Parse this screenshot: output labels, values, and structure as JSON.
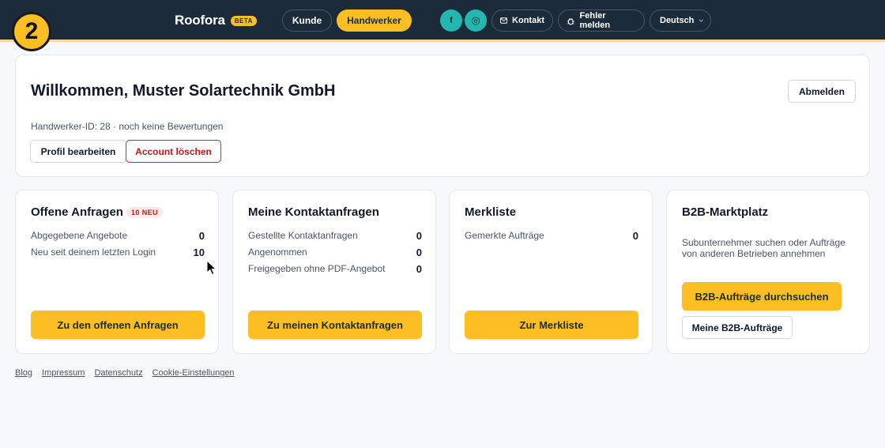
{
  "step_badge": "2",
  "header": {
    "brand": "Roofora",
    "beta": "BETA",
    "nav": {
      "kunde": "Kunde",
      "handwerker": "Handwerker"
    },
    "social": {
      "facebook": "f",
      "instagram": "◎"
    },
    "kontakt": "Kontakt",
    "fehler_melden": "Fehler melden",
    "language": "Deutsch"
  },
  "welcome": {
    "title": "Willkommen, Muster Solartechnik GmbH",
    "logout": "Abmelden",
    "meta": "Handwerker-ID: 28 · noch keine Bewertungen",
    "edit_profile": "Profil bearbeiten",
    "delete_account": "Account löschen"
  },
  "cards": {
    "offene": {
      "title": "Offene Anfragen",
      "badge": "10 NEU",
      "rows": [
        {
          "label": "Abgegebene Angebote",
          "value": "0"
        },
        {
          "label": "Neu seit deinem letzten Login",
          "value": "10"
        }
      ],
      "button": "Zu den offenen Anfragen"
    },
    "kontakt": {
      "title": "Meine Kontaktanfragen",
      "rows": [
        {
          "label": "Gestellte Kontaktanfragen",
          "value": "0"
        },
        {
          "label": "Angenommen",
          "value": "0"
        },
        {
          "label": "Freigegeben ohne PDF-Angebot",
          "value": "0"
        }
      ],
      "button": "Zu meinen Kontaktanfragen"
    },
    "merkliste": {
      "title": "Merkliste",
      "rows": [
        {
          "label": "Gemerkte Aufträge",
          "value": "0"
        }
      ],
      "button": "Zur Merkliste"
    },
    "b2b": {
      "title": "B2B-Marktplatz",
      "description": "Subunternehmer suchen oder Aufträge von anderen Betrieben annehmen",
      "button_primary": "B2B-Aufträge durchsuchen",
      "button_secondary": "Meine B2B-Aufträge"
    }
  },
  "footer": {
    "links": [
      "Blog",
      "Impressum",
      "Datenschutz",
      "Cookie-Einstellungen"
    ]
  },
  "colors": {
    "header_bg": "#1c2b3a",
    "accent": "#fbbf24",
    "social": "#22b8b0",
    "danger": "#b91c1c"
  }
}
